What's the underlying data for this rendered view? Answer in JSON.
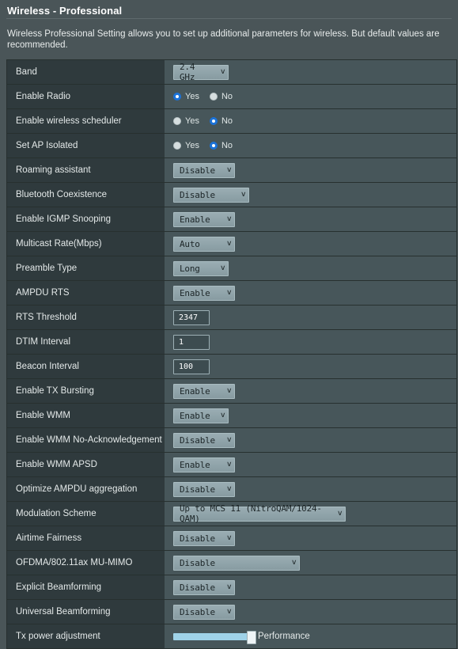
{
  "header": {
    "title": "Wireless - Professional",
    "description": "Wireless Professional Setting allows you to set up additional parameters for wireless. But default values are recommended."
  },
  "radio_labels": {
    "yes": "Yes",
    "no": "No"
  },
  "colors": {
    "page_bg": "#4a5558",
    "label_col_bg": "#2f3a3d",
    "value_col_bg": "#47565a",
    "select_bg": "#8fa3a9",
    "radio_selected": "#1b72d8",
    "slider_fill": "#9fd2e8"
  },
  "rows": [
    {
      "label": "Band",
      "type": "select",
      "value": "2.4 GHz",
      "width": "w-sm"
    },
    {
      "label": "Enable Radio",
      "type": "radio",
      "selected": "yes"
    },
    {
      "label": "Enable wireless scheduler",
      "type": "radio",
      "selected": "no"
    },
    {
      "label": "Set AP Isolated",
      "type": "radio",
      "selected": "no"
    },
    {
      "label": "Roaming assistant",
      "type": "select",
      "value": "Disable",
      "width": "w-md"
    },
    {
      "label": "Bluetooth Coexistence",
      "type": "select",
      "value": "Disable",
      "width": "w-lg"
    },
    {
      "label": "Enable IGMP Snooping",
      "type": "select",
      "value": "Enable",
      "width": "w-md"
    },
    {
      "label": "Multicast Rate(Mbps)",
      "type": "select",
      "value": "Auto",
      "width": "w-md"
    },
    {
      "label": "Preamble Type",
      "type": "select",
      "value": "Long",
      "width": "w-sm"
    },
    {
      "label": "AMPDU RTS",
      "type": "select",
      "value": "Enable",
      "width": "w-md"
    },
    {
      "label": "RTS Threshold",
      "type": "input",
      "value": "2347"
    },
    {
      "label": "DTIM Interval",
      "type": "input",
      "value": "1"
    },
    {
      "label": "Beacon Interval",
      "type": "input",
      "value": "100"
    },
    {
      "label": "Enable TX Bursting",
      "type": "select",
      "value": "Enable",
      "width": "w-md"
    },
    {
      "label": "Enable WMM",
      "type": "select",
      "value": "Enable",
      "width": "w-sm"
    },
    {
      "label": "Enable WMM No-Acknowledgement",
      "type": "select",
      "value": "Disable",
      "width": "w-md"
    },
    {
      "label": "Enable WMM APSD",
      "type": "select",
      "value": "Enable",
      "width": "w-md"
    },
    {
      "label": "Optimize AMPDU aggregation",
      "type": "select",
      "value": "Disable",
      "width": "w-md"
    },
    {
      "label": "Modulation Scheme",
      "type": "select",
      "value": "Up to MCS 11 (NitroQAM/1024-QAM)",
      "width": "w-xxl"
    },
    {
      "label": "Airtime Fairness",
      "type": "select",
      "value": "Disable",
      "width": "w-md"
    },
    {
      "label": "OFDMA/802.11ax MU-MIMO",
      "type": "select",
      "value": "Disable",
      "width": "w-xl"
    },
    {
      "label": "Explicit Beamforming",
      "type": "select",
      "value": "Disable",
      "width": "w-md"
    },
    {
      "label": "Universal Beamforming",
      "type": "select",
      "value": "Disable",
      "width": "w-md"
    },
    {
      "label": "Tx power adjustment",
      "type": "slider",
      "value": "Performance"
    }
  ]
}
